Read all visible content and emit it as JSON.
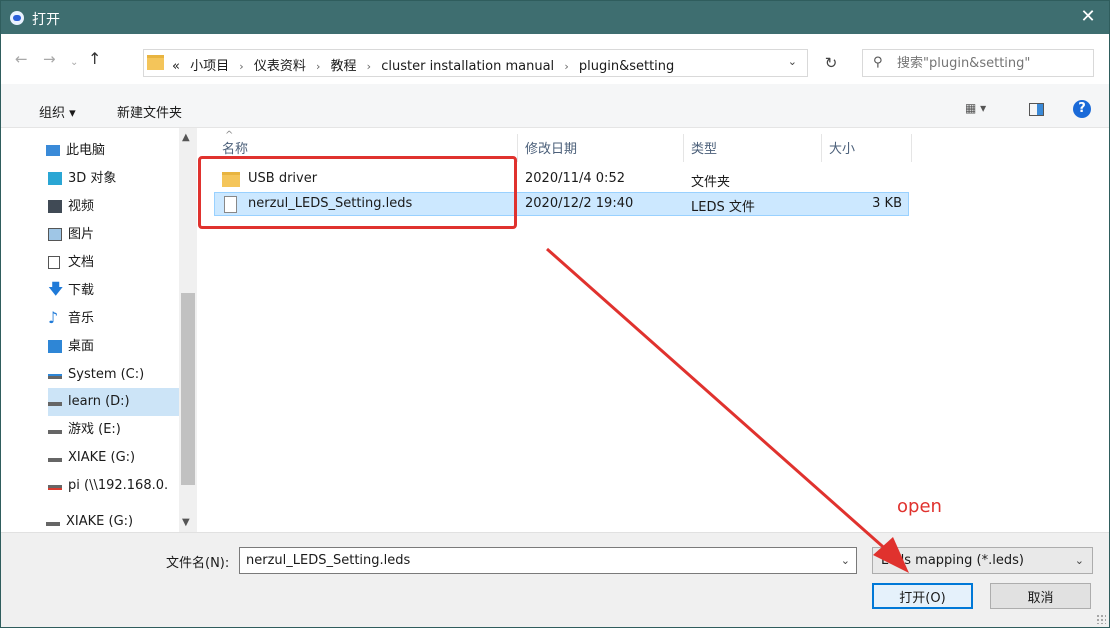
{
  "window": {
    "title": "打开",
    "close_glyph": "✕"
  },
  "nav_buttons": {
    "back": "←",
    "forward": "→",
    "recent": "⌄",
    "up": "↑"
  },
  "address": {
    "prefix": "«",
    "segments": [
      "小项目",
      "仪表资料",
      "教程",
      "cluster installation manual",
      "plugin&setting"
    ],
    "separator": "›",
    "dropdown": "⌄",
    "refresh": "↻"
  },
  "search": {
    "placeholder": "搜索\"plugin&setting\"",
    "icon": "search-icon"
  },
  "toolbar": {
    "organize": "组织 ▾",
    "new_folder": "新建文件夹",
    "view": "▦ ▾",
    "help": "?"
  },
  "nav_pane": {
    "items": [
      {
        "label": "此电脑",
        "icon": "computer-icon"
      },
      {
        "label": "3D 对象",
        "icon": "cube-icon"
      },
      {
        "label": "视频",
        "icon": "video-icon"
      },
      {
        "label": "图片",
        "icon": "picture-icon"
      },
      {
        "label": "文档",
        "icon": "document-icon"
      },
      {
        "label": "下载",
        "icon": "download-icon"
      },
      {
        "label": "音乐",
        "icon": "music-icon"
      },
      {
        "label": "桌面",
        "icon": "desktop-icon"
      },
      {
        "label": "System (C:)",
        "icon": "system-drive-icon"
      },
      {
        "label": "learn (D:)",
        "icon": "drive-icon"
      },
      {
        "label": "游戏 (E:)",
        "icon": "drive-icon"
      },
      {
        "label": "XIAKE (G:)",
        "icon": "drive-icon"
      },
      {
        "label": "pi (\\\\192.168.0.",
        "icon": "network-drive-icon"
      },
      {
        "label": "XIAKE (G:)",
        "icon": "drive-icon"
      }
    ],
    "selected_index": 9,
    "scroll_up": "▲",
    "scroll_down": "▼"
  },
  "columns": {
    "name": "名称",
    "modified": "修改日期",
    "type": "类型",
    "size": "大小",
    "sort_glyph": "^"
  },
  "files": [
    {
      "name": "USB driver",
      "modified": "2020/11/4 0:52",
      "type": "文件夹",
      "size": ""
    },
    {
      "name": "nerzul_LEDS_Setting.leds",
      "modified": "2020/12/2 19:40",
      "type": "LEDS 文件",
      "size": "3 KB"
    }
  ],
  "annotation": {
    "label": "open",
    "color": "#e0322e"
  },
  "bottom": {
    "filename_label": "文件名(N):",
    "filename_value": "nerzul_LEDS_Setting.leds",
    "filetype_value": "Leds mapping (*.leds)",
    "dropdown": "⌄",
    "open_button": "打开(O)",
    "cancel_button": "取消"
  },
  "colors": {
    "titlebar": "#3e6e70",
    "selection": "#cce8ff",
    "accent": "#0078d7",
    "annotation": "#e0322e"
  }
}
